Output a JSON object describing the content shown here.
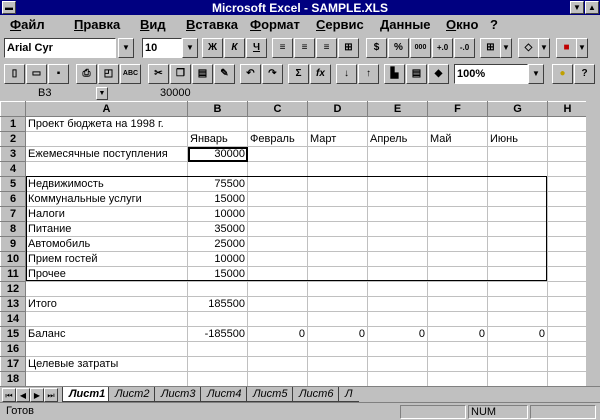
{
  "window": {
    "title": "Microsoft Excel - SAMPLE.XLS"
  },
  "menu": [
    "Файл",
    "Правка",
    "Вид",
    "Вставка",
    "Формат",
    "Сервис",
    "Данные",
    "Окно",
    "?"
  ],
  "format_toolbar": {
    "font": "Arial Cyr",
    "size": "10",
    "bold": "Ж",
    "italic": "К",
    "underline": "Ч",
    "percent": "%",
    "thousands": "000"
  },
  "standard_toolbar": {
    "zoom": "100%",
    "sum": "Σ",
    "function": "fx"
  },
  "formula_bar": {
    "name_box": "B3",
    "value": "30000"
  },
  "columns": [
    "A",
    "B",
    "C",
    "D",
    "E",
    "F",
    "G",
    "H"
  ],
  "rows": [
    {
      "n": "1",
      "cells": [
        "Проект бюджета на 1998 г.",
        "",
        "",
        "",
        "",
        "",
        "",
        ""
      ]
    },
    {
      "n": "2",
      "cells": [
        "",
        "Январь",
        "Февраль",
        "Март",
        "Апрель",
        "Май",
        "Июнь",
        ""
      ]
    },
    {
      "n": "3",
      "cells": [
        "Ежемесячные поступления",
        "30000",
        "",
        "",
        "",
        "",
        "",
        ""
      ]
    },
    {
      "n": "4",
      "cells": [
        "",
        "",
        "",
        "",
        "",
        "",
        "",
        ""
      ]
    },
    {
      "n": "5",
      "cells": [
        "Недвижимость",
        "75500",
        "",
        "",
        "",
        "",
        "",
        ""
      ]
    },
    {
      "n": "6",
      "cells": [
        "Коммунальные услуги",
        "15000",
        "",
        "",
        "",
        "",
        "",
        ""
      ]
    },
    {
      "n": "7",
      "cells": [
        "Налоги",
        "10000",
        "",
        "",
        "",
        "",
        "",
        ""
      ]
    },
    {
      "n": "8",
      "cells": [
        "Питание",
        "35000",
        "",
        "",
        "",
        "",
        "",
        ""
      ]
    },
    {
      "n": "9",
      "cells": [
        "Автомобиль",
        "25000",
        "",
        "",
        "",
        "",
        "",
        ""
      ]
    },
    {
      "n": "10",
      "cells": [
        "Прием гостей",
        "10000",
        "",
        "",
        "",
        "",
        "",
        ""
      ]
    },
    {
      "n": "11",
      "cells": [
        "Прочее",
        "15000",
        "",
        "",
        "",
        "",
        "",
        ""
      ]
    },
    {
      "n": "12",
      "cells": [
        "",
        "",
        "",
        "",
        "",
        "",
        "",
        ""
      ]
    },
    {
      "n": "13",
      "cells": [
        "Итого",
        "185500",
        "",
        "",
        "",
        "",
        "",
        ""
      ]
    },
    {
      "n": "14",
      "cells": [
        "",
        "",
        "",
        "",
        "",
        "",
        "",
        ""
      ]
    },
    {
      "n": "15",
      "cells": [
        "Баланс",
        "-185500",
        "0",
        "0",
        "0",
        "0",
        "0",
        ""
      ]
    },
    {
      "n": "16",
      "cells": [
        "",
        "",
        "",
        "",
        "",
        "",
        "",
        ""
      ]
    },
    {
      "n": "17",
      "cells": [
        "Целевые затраты",
        "",
        "",
        "",
        "",
        "",
        "",
        ""
      ]
    },
    {
      "n": "18",
      "cells": [
        "",
        "",
        "",
        "",
        "",
        "",
        "",
        ""
      ]
    }
  ],
  "sheets": [
    "Лист1",
    "Лист2",
    "Лист3",
    "Лист4",
    "Лист5",
    "Лист6",
    "Л"
  ],
  "status": {
    "text": "Готов",
    "num": "NUM"
  }
}
